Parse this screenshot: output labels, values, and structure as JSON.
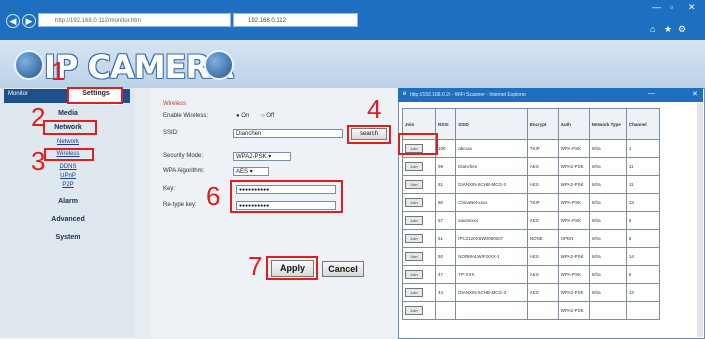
{
  "browser": {
    "address": "http://192.168.0.112/monitor.htm",
    "tab_title": "192.168.0.112",
    "back_icon": "back-arrow-icon",
    "forward_icon": "forward-arrow-icon"
  },
  "header": {
    "title": "IP CAMERA"
  },
  "nav": {
    "tab_monitor": "Monitor",
    "tab_settings": "Settings",
    "media": "Media",
    "network": "Network",
    "network_links": [
      "Network",
      "Wireless",
      "DDNS",
      "UPnP",
      "P2P"
    ],
    "alarm": "Alarm",
    "advanced": "Advanced",
    "system": "System"
  },
  "form": {
    "section": "Wireless",
    "enable_label": "Enable Wireless:",
    "enable_on": "On",
    "enable_off": "Off",
    "ssid_label": "SSID:",
    "ssid_value": "Dianchen",
    "search_label": "search",
    "security_label": "Security Mode:",
    "security_value": "WPA2-PSK",
    "wpa_label": "WPA Algorithm:",
    "wpa_value": "AES",
    "key_label": "Key:",
    "key_value": "●●●●●●●●●●",
    "retype_label": "Re-type key:",
    "retype_value": "●●●●●●●●●●",
    "apply_label": "Apply",
    "cancel_label": "Cancel"
  },
  "steps": [
    "1",
    "2",
    "3",
    "4",
    "5",
    "6",
    "7"
  ],
  "popup": {
    "title": "http://192.168.0.2/ - WiFi Scanner - Internet Explorer",
    "columns": [
      "Join",
      "RSSI",
      "SSID",
      "Encrypt",
      "Auth",
      "Network Type",
      "Channel"
    ],
    "join_label": "Join",
    "rows": [
      {
        "rssi": "100",
        "ssid": "abcxxx",
        "encrypt": "TKIP",
        "auth": "WPA-PSK",
        "type": "Infra",
        "channel": "1"
      },
      {
        "rssi": "99",
        "ssid": "Dianchen",
        "encrypt": "AES",
        "auth": "WPA2-PSK",
        "type": "Infra",
        "channel": "11"
      },
      {
        "rssi": "81",
        "ssid": "DIANXIN-6CHB-MCG-3",
        "encrypt": "AES",
        "auth": "WPA2-PSK",
        "type": "Infra",
        "channel": "11"
      },
      {
        "rssi": "80",
        "ssid": "ChinaNet-xxxx",
        "encrypt": "TKIP",
        "auth": "WPA-PSK",
        "type": "Infra",
        "channel": "13"
      },
      {
        "rssi": "57",
        "ssid": "xiaomixxx",
        "encrypt": "AES",
        "auth": "WPA-PSK",
        "type": "Infra",
        "channel": "6"
      },
      {
        "rssi": "51",
        "ssid": "IPC2120X6W0090007",
        "encrypt": "NONE",
        "auth": "OPEN",
        "type": "Infra",
        "channel": "6"
      },
      {
        "rssi": "50",
        "ssid": "NORMALWIFIXXX-1",
        "encrypt": "AES",
        "auth": "WPA2-PSK",
        "type": "Infra",
        "channel": "14"
      },
      {
        "rssi": "47",
        "ssid": "TP-XXX",
        "encrypt": "AES",
        "auth": "WPA-PSK",
        "type": "Infra",
        "channel": "6"
      },
      {
        "rssi": "44",
        "ssid": "DIANXIN-6CHB-MCG-3",
        "encrypt": "AES",
        "auth": "WPA2-PSK",
        "type": "Infra",
        "channel": "13"
      },
      {
        "rssi": "",
        "ssid": "",
        "encrypt": "",
        "auth": "WPA2-PSK",
        "type": "",
        "channel": ""
      }
    ]
  },
  "colors": {
    "accent": "#1e6fbf",
    "highlight": "#e01e1e"
  }
}
